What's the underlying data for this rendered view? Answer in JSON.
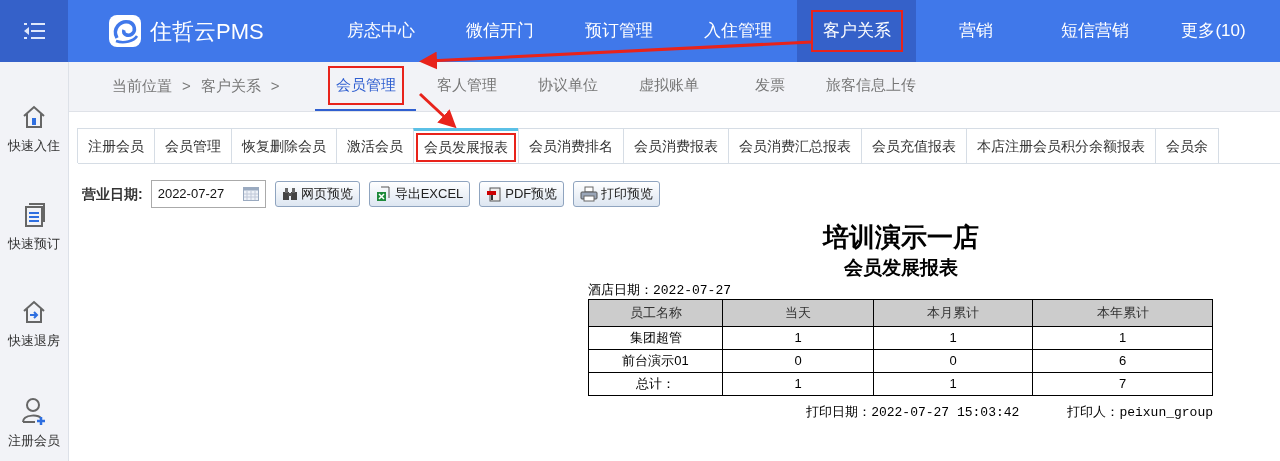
{
  "brand": {
    "name": "住哲云PMS"
  },
  "top_nav": [
    {
      "label": "房态中心",
      "selected": false,
      "highlighted": false
    },
    {
      "label": "微信开门",
      "selected": false,
      "highlighted": false
    },
    {
      "label": "预订管理",
      "selected": false,
      "highlighted": false
    },
    {
      "label": "入住管理",
      "selected": false,
      "highlighted": false
    },
    {
      "label": "客户关系",
      "selected": true,
      "highlighted": true
    },
    {
      "label": "营销",
      "selected": false,
      "highlighted": false
    },
    {
      "label": "短信营销",
      "selected": false,
      "highlighted": false
    },
    {
      "label": "更多(10)",
      "selected": false,
      "highlighted": false
    }
  ],
  "sidebar": [
    {
      "label": "快速入住",
      "kind": "checkin"
    },
    {
      "label": "快速预订",
      "kind": "booking"
    },
    {
      "label": "快速退房",
      "kind": "checkout"
    },
    {
      "label": "注册会员",
      "kind": "member"
    }
  ],
  "breadcrumb": [
    "当前位置",
    ">",
    "客户关系",
    ">"
  ],
  "sub_nav": [
    {
      "label": "会员管理",
      "selected": true,
      "highlighted": true
    },
    {
      "label": "客人管理",
      "selected": false,
      "highlighted": false
    },
    {
      "label": "协议单位",
      "selected": false,
      "highlighted": false
    },
    {
      "label": "虚拟账单",
      "selected": false,
      "highlighted": false
    },
    {
      "label": "发票",
      "selected": false,
      "highlighted": false
    },
    {
      "label": "旅客信息上传",
      "selected": false,
      "highlighted": false
    }
  ],
  "report_tabs": [
    {
      "label": "注册会员",
      "selected": false,
      "highlighted": false
    },
    {
      "label": "会员管理",
      "selected": false,
      "highlighted": false
    },
    {
      "label": "恢复删除会员",
      "selected": false,
      "highlighted": false
    },
    {
      "label": "激活会员",
      "selected": false,
      "highlighted": false
    },
    {
      "label": "会员发展报表",
      "selected": true,
      "highlighted": true
    },
    {
      "label": "会员消费排名",
      "selected": false,
      "highlighted": false
    },
    {
      "label": "会员消费报表",
      "selected": false,
      "highlighted": false
    },
    {
      "label": "会员消费汇总报表",
      "selected": false,
      "highlighted": false
    },
    {
      "label": "会员充值报表",
      "selected": false,
      "highlighted": false
    },
    {
      "label": "本店注册会员积分余额报表",
      "selected": false,
      "highlighted": false
    },
    {
      "label": "会员余",
      "selected": false,
      "highlighted": false
    }
  ],
  "toolbar": {
    "date_label": "营业日期:",
    "date_value": "2022-07-27",
    "buttons": [
      {
        "label": "网页预览",
        "kind": "web"
      },
      {
        "label": "导出EXCEL",
        "kind": "excel"
      },
      {
        "label": "PDF预览",
        "kind": "pdf"
      },
      {
        "label": "打印预览",
        "kind": "print"
      }
    ]
  },
  "report": {
    "title": "培训演示一店",
    "subtitle": "会员发展报表",
    "hotel_date": "酒店日期：2022-07-27",
    "columns": [
      "员工名称",
      "当天",
      "本月累计",
      "本年累计"
    ],
    "rows": [
      [
        "集团超管",
        "1",
        "1",
        "1"
      ],
      [
        "前台演示01",
        "0",
        "0",
        "6"
      ],
      [
        "总计：",
        "1",
        "1",
        "7"
      ]
    ],
    "print_date": "打印日期：2022-07-27 15:03:42",
    "printer": "打印人：peixun_group"
  }
}
